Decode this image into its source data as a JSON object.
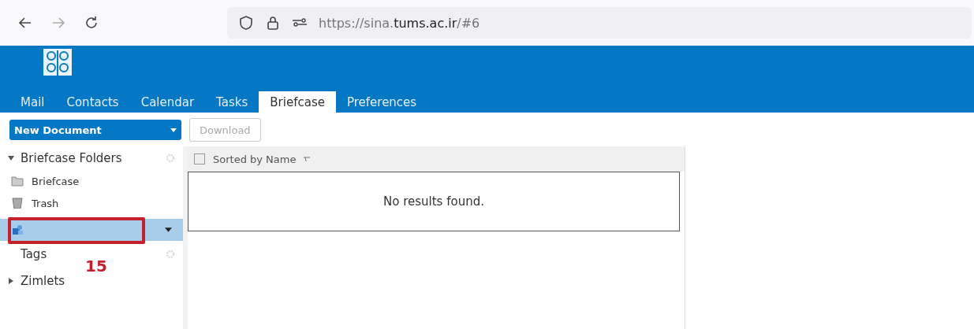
{
  "browser": {
    "url": "https://sina.**tums.ac.ir**/#6"
  },
  "tabs": [
    {
      "label": "Mail",
      "selected": false
    },
    {
      "label": "Contacts",
      "selected": false
    },
    {
      "label": "Calendar",
      "selected": false
    },
    {
      "label": "Tasks",
      "selected": false
    },
    {
      "label": "Briefcase",
      "selected": true
    },
    {
      "label": "Preferences",
      "selected": false
    }
  ],
  "toolbar": {
    "new_button": "New Document",
    "download_button": "Download",
    "download_disabled": true
  },
  "sidebar": {
    "header": {
      "label": "Briefcase Folders",
      "expanded": true
    },
    "folders": [
      {
        "kind": "folder",
        "label": "Briefcase",
        "selected": false
      },
      {
        "kind": "trash",
        "label": "Trash",
        "selected": false
      },
      {
        "kind": "shared",
        "selected": true
      }
    ],
    "sections": [
      {
        "label": "Tags"
      },
      {
        "label": "Zimlets",
        "expanded": false
      }
    ]
  },
  "list": {
    "sort_label": "Sorted by Name",
    "select_all_checked": false,
    "empty_message": "No results found."
  },
  "annotation": {
    "label": "15"
  }
}
